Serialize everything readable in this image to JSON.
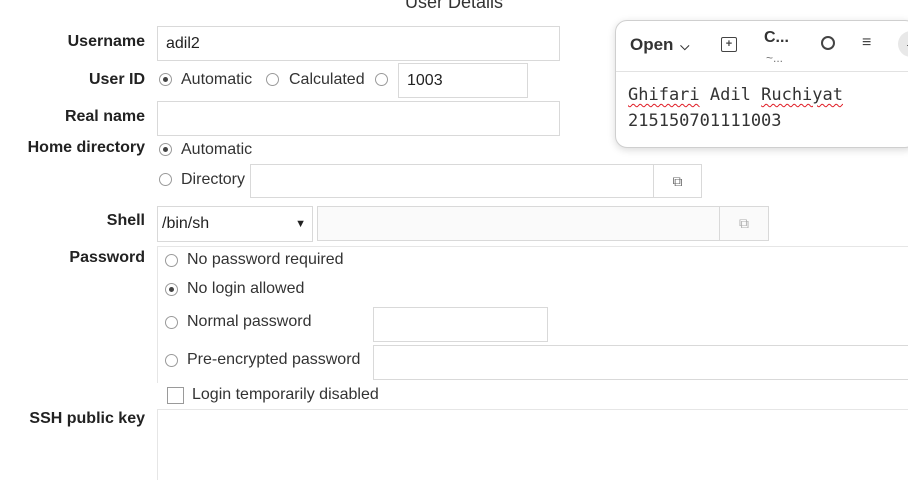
{
  "window": {
    "title": "User Details"
  },
  "form": {
    "username": {
      "label": "Username",
      "value": "adil2"
    },
    "user_id": {
      "label": "User ID",
      "opt_auto": "Automatic",
      "opt_calc": "Calculated",
      "value": "1003",
      "selected": "Automatic"
    },
    "real_name": {
      "label": "Real name",
      "value": ""
    },
    "home_dir": {
      "label": "Home directory",
      "opt_auto": "Automatic",
      "opt_dir": "Directory",
      "value": "",
      "selected": "Automatic"
    },
    "shell": {
      "label": "Shell",
      "value": "/bin/sh",
      "other_value": ""
    },
    "password": {
      "label": "Password",
      "opt_none": "No password required",
      "opt_nologin": "No login allowed",
      "opt_normal": "Normal password",
      "opt_pre": "Pre-encrypted password",
      "selected": "No login allowed"
    },
    "login_disabled": {
      "label": "Login temporarily disabled",
      "checked": false
    },
    "ssh_key": {
      "label": "SSH public key",
      "value": ""
    }
  },
  "editor": {
    "open_label": "Open",
    "title_short": "C...",
    "subtitle_short": "~...",
    "line1": [
      "Ghifari",
      "Adil",
      "Ruchiyat"
    ],
    "line2": "215150701111003"
  }
}
